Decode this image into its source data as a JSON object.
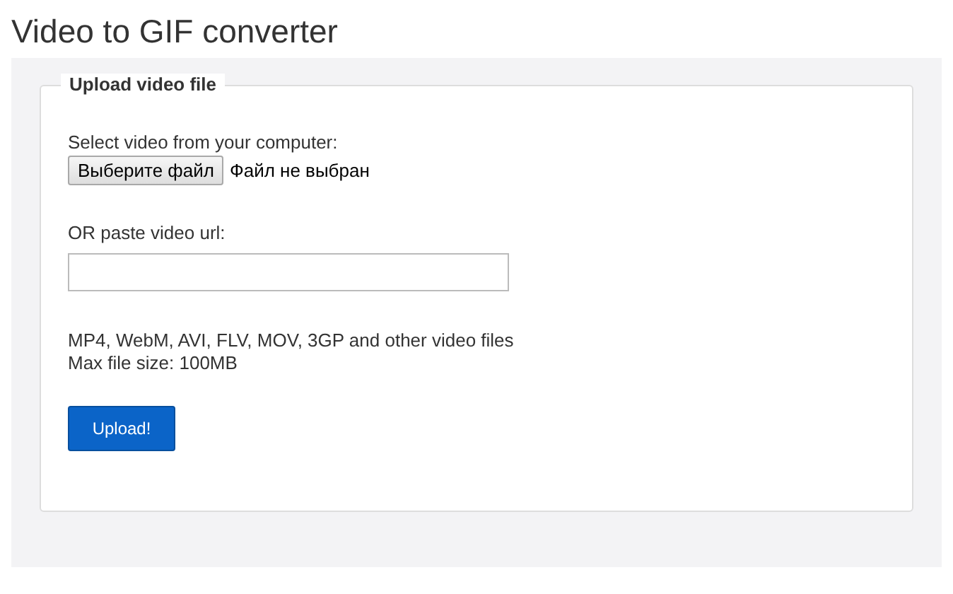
{
  "title": "Video to GIF converter",
  "form": {
    "legend": "Upload video file",
    "file_label": "Select video from your computer:",
    "file_button": "Выберите файл",
    "file_status": "Файл не выбран",
    "url_label": "OR paste video url:",
    "formats": "MP4, WebM, AVI, FLV, MOV, 3GP and other video files",
    "max_size": "Max file size: 100MB",
    "submit": "Upload!"
  }
}
